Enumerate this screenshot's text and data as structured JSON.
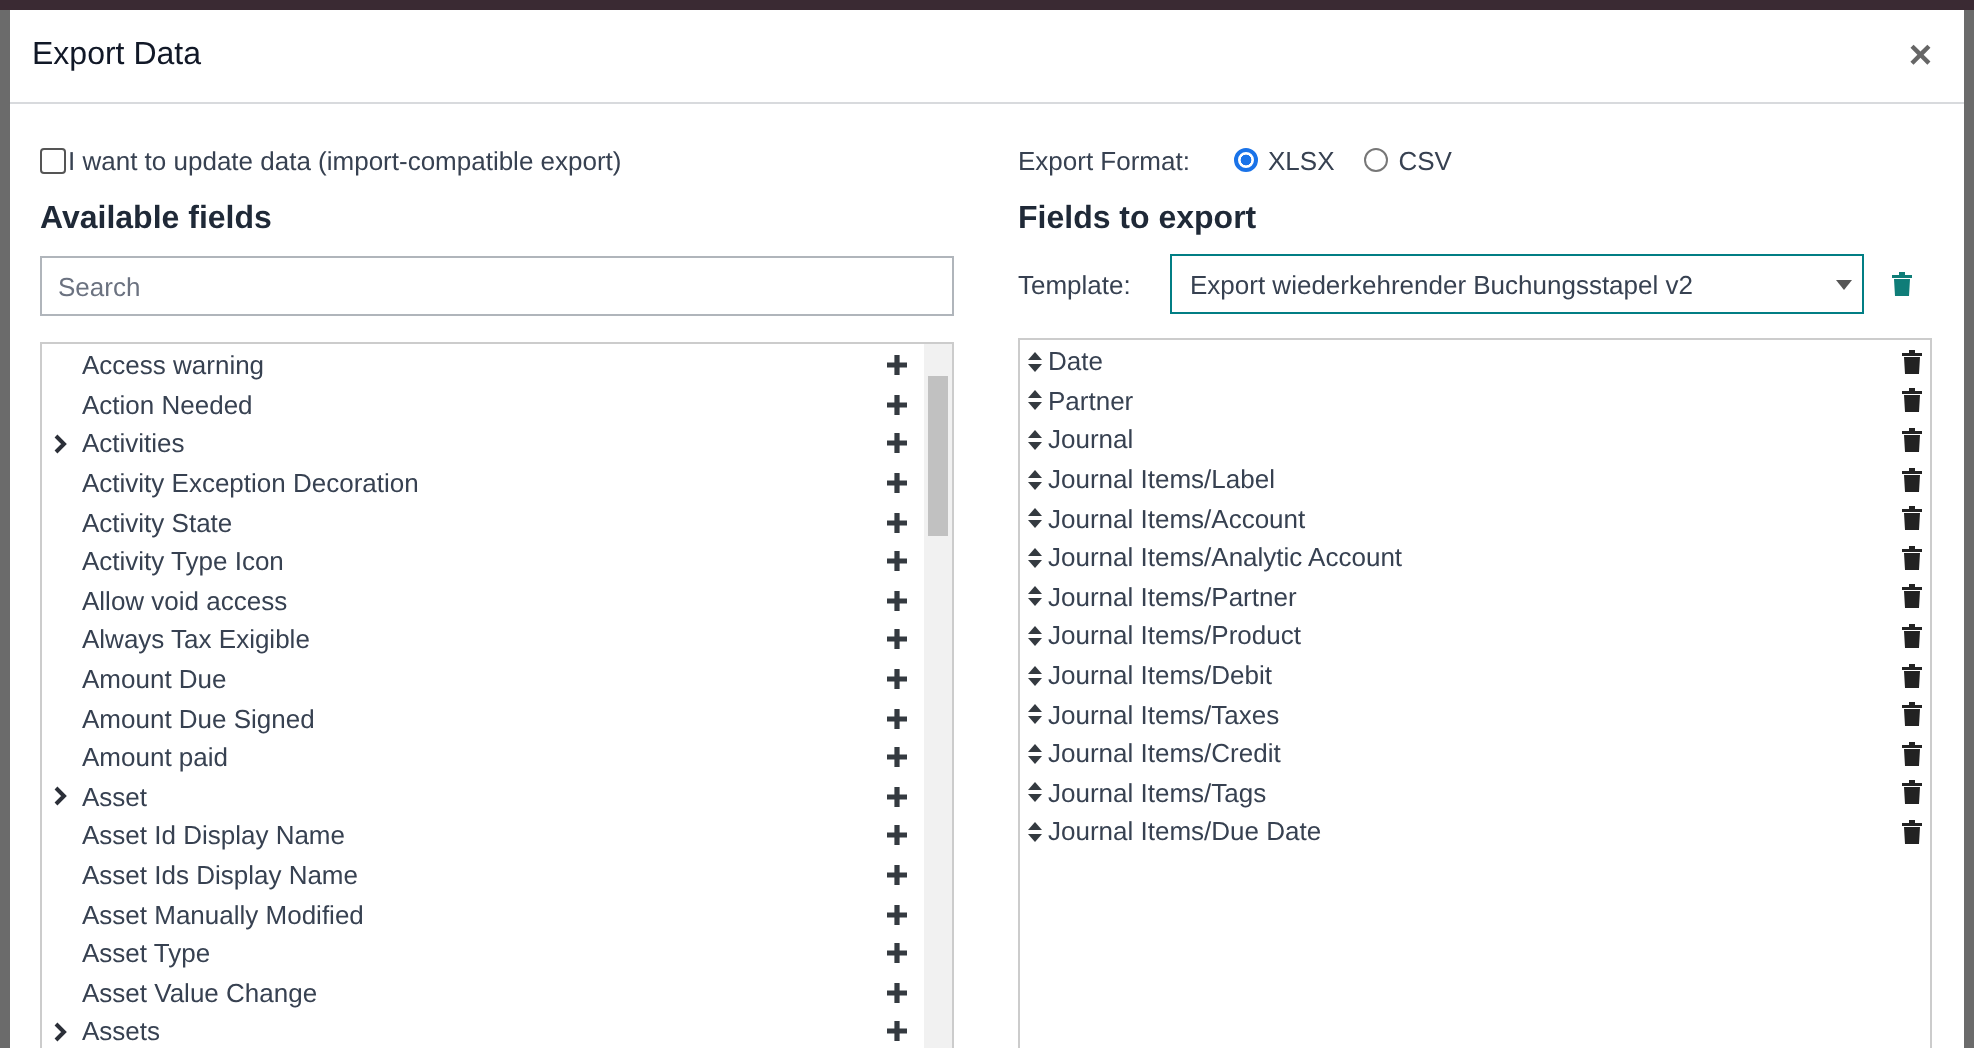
{
  "dialog": {
    "title": "Export Data",
    "close": "×"
  },
  "update_option": {
    "label": "I want to update data (import-compatible export)",
    "checked": false
  },
  "available_fields": {
    "title": "Available fields",
    "search": {
      "placeholder": "Search"
    },
    "items": [
      {
        "label": "Access warning",
        "expandable": false
      },
      {
        "label": "Action Needed",
        "expandable": false
      },
      {
        "label": "Activities",
        "expandable": true
      },
      {
        "label": "Activity Exception Decoration",
        "expandable": false
      },
      {
        "label": "Activity State",
        "expandable": false
      },
      {
        "label": "Activity Type Icon",
        "expandable": false
      },
      {
        "label": "Allow void access",
        "expandable": false
      },
      {
        "label": "Always Tax Exigible",
        "expandable": false
      },
      {
        "label": "Amount Due",
        "expandable": false
      },
      {
        "label": "Amount Due Signed",
        "expandable": false
      },
      {
        "label": "Amount paid",
        "expandable": false
      },
      {
        "label": "Asset",
        "expandable": true
      },
      {
        "label": "Asset Id Display Name",
        "expandable": false
      },
      {
        "label": "Asset Ids Display Name",
        "expandable": false
      },
      {
        "label": "Asset Manually Modified",
        "expandable": false
      },
      {
        "label": "Asset Type",
        "expandable": false
      },
      {
        "label": "Asset Value Change",
        "expandable": false
      },
      {
        "label": "Assets",
        "expandable": true
      }
    ]
  },
  "export_format": {
    "label": "Export Format:",
    "options": [
      {
        "label": "XLSX",
        "selected": true
      },
      {
        "label": "CSV",
        "selected": false
      }
    ]
  },
  "fields_to_export": {
    "title": "Fields to export",
    "template": {
      "label": "Template:",
      "value": "Export wiederkehrender Buchungsstapel v2"
    },
    "items": [
      "Date",
      "Partner",
      "Journal",
      "Journal Items/Label",
      "Journal Items/Account",
      "Journal Items/Analytic Account",
      "Journal Items/Partner",
      "Journal Items/Product",
      "Journal Items/Debit",
      "Journal Items/Taxes",
      "Journal Items/Credit",
      "Journal Items/Tags",
      "Journal Items/Due Date"
    ]
  }
}
